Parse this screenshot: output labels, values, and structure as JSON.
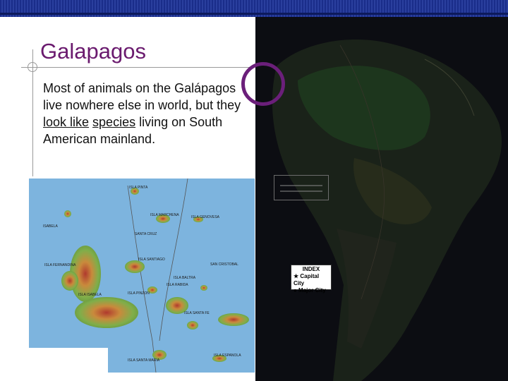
{
  "slide": {
    "title": "Galapagos",
    "body_text_before": "Most of animals on the Galápagos live nowhere else in world, but they ",
    "body_text_underlined_1": "look like",
    "body_text_space": " ",
    "body_text_underlined_2": "species",
    "body_text_after": " living on South American mainland."
  },
  "sa_map": {
    "index_title": "INDEX",
    "index_capital": "★ Capital City",
    "index_major": "● Major City"
  },
  "galapagos_map": {
    "labels": [
      "ISLA PINTA",
      "ISLA MARCHENA",
      "ISLA GENOVESA",
      "ISABELA",
      "SANTA CRUZ",
      "ISLA SANTIAGO",
      "ISLA FERNANDINA",
      "ISLA RABIDA",
      "ISLA PINZON",
      "ISLA ISABELA",
      "ISLA BALTRA",
      "SAN CRISTOBAL",
      "ISLA SANTA FE",
      "ISLA SANTA MARIA",
      "ISLA ESPANOLA"
    ]
  },
  "colors": {
    "title": "#6a1a6e",
    "highlight_circle": "#6b1f7a",
    "top_bar": "#1a2d8a"
  }
}
